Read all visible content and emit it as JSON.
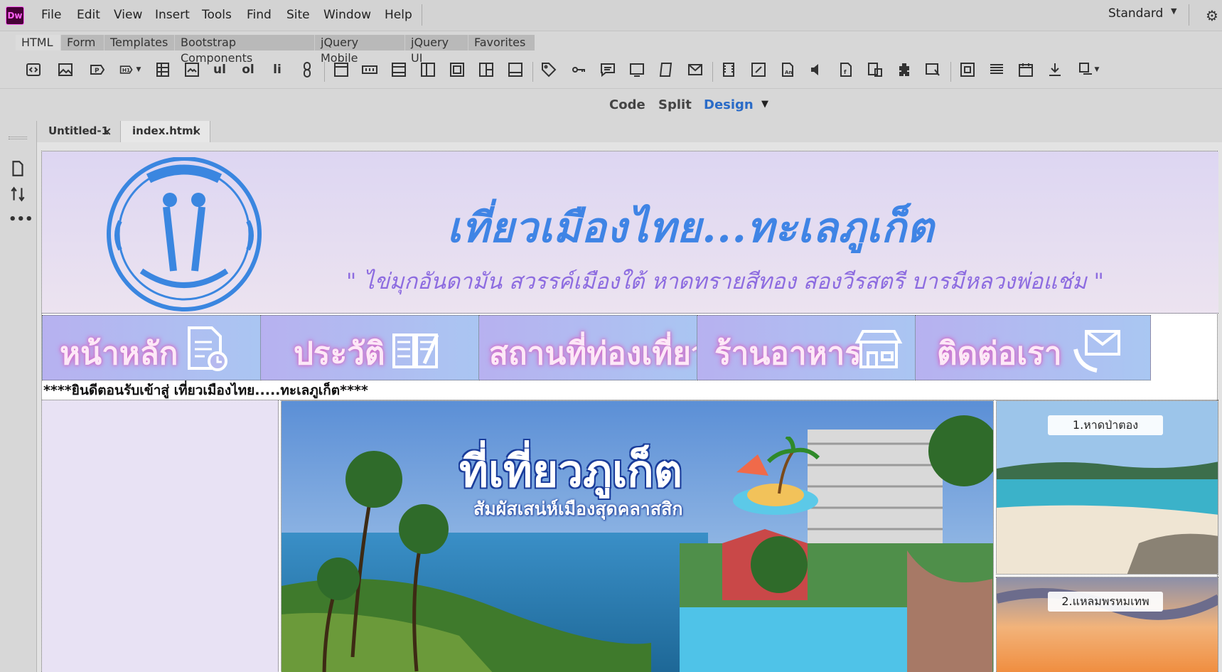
{
  "app": {
    "logo_text": "Dw",
    "menu": [
      "File",
      "Edit",
      "View",
      "Insert",
      "Tools",
      "Find",
      "Site",
      "Window",
      "Help"
    ],
    "workspace": "Standard",
    "insert_tabs": [
      "HTML",
      "Form",
      "Templates",
      "Bootstrap Components",
      "jQuery Mobile",
      "jQuery UI",
      "Favorites"
    ],
    "toolbar_text_buttons": {
      "ul": "ul",
      "ol": "ol",
      "li": "li"
    },
    "views": {
      "code": "Code",
      "split": "Split",
      "design": "Design"
    },
    "doc_tabs": [
      {
        "label": "Untitled-1"
      },
      {
        "label": "index.html",
        "active": true
      }
    ]
  },
  "page": {
    "title": "เที่ยวเมืองไทย...ทะเลภูเก็ต",
    "slogan": "\" ไข่มุกอันดามัน สวรรค์เมืองใต้ หาดทรายสีทอง สองวีรสตรี บารมีหลวงพ่อแช่ม \"",
    "nav": [
      {
        "label": "หน้าหลัก",
        "icon": "document-clock-icon"
      },
      {
        "label": "ประวัติ",
        "icon": "book-pen-icon"
      },
      {
        "label": "สถานที่ท่องเที่ยว",
        "icon": "none"
      },
      {
        "label": "ร้านอาหาร",
        "icon": "shop-icon"
      },
      {
        "label": "ติดต่อเรา",
        "icon": "envelope-phone-icon"
      }
    ],
    "welcome": "****ยินดีตอนรับเข้าสู่ เที่ยวเมืองไทย.....ทะเลภูเก็ต****",
    "hero": {
      "title": "ที่เที่ยวภูเก็ต",
      "subtitle": "สัมผัสเสน่ห์เมืองสุดคลาสสิก"
    },
    "side_images": [
      {
        "label": "1.หาดป่าตอง"
      },
      {
        "label": "2.แหลมพรหมเทพ"
      }
    ]
  },
  "colors": {
    "accent": "#2a6bc7",
    "title_blue": "#3f84e5",
    "slogan_purple": "#8d6ce0",
    "dw_logo": "#ff61f6"
  }
}
